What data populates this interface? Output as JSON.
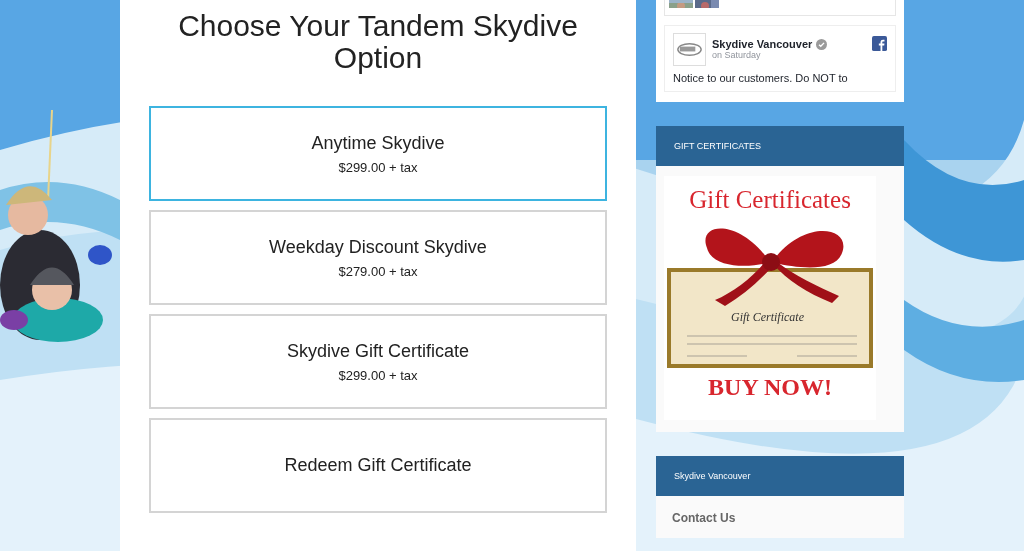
{
  "page": {
    "title": "Choose Your Tandem Skydive Option"
  },
  "options": [
    {
      "name": "Anytime Skydive",
      "price": "$299.00 + tax",
      "selected": true
    },
    {
      "name": "Weekday Discount Skydive",
      "price": "$279.00 + tax",
      "selected": false
    },
    {
      "name": "Skydive Gift Certificate",
      "price": "$299.00 + tax",
      "selected": false
    },
    {
      "name": "Redeem Gift Certificate",
      "selected": false
    }
  ],
  "sidebar": {
    "facebook": {
      "page_name": "Skydive Vancouver",
      "time": "on Saturday",
      "post": "Notice to our customers. Do NOT to"
    },
    "widgets": [
      {
        "title": "GIFT CERTIFICATES",
        "kind": "banner",
        "heading": "Gift Certificates",
        "certificate_title": "Gift Certificate",
        "cta": "BUY NOW!"
      },
      {
        "title": "Skydive Vancouver",
        "kind": "links",
        "heading": "Contact Us"
      }
    ]
  }
}
